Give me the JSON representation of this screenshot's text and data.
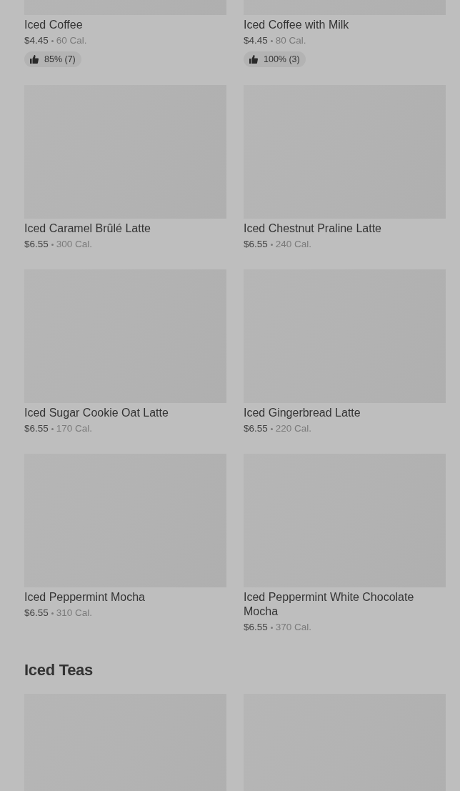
{
  "sections": [
    {
      "items": [
        {
          "kind": "picture",
          "name": "Iced Coffee",
          "price": "$4.45",
          "calories": "60 Cal.",
          "rating": "85% (7)"
        },
        {
          "kind": "picture",
          "name": "Iced Coffee with Milk",
          "price": "$4.45",
          "calories": "80 Cal.",
          "rating": "100% (3)"
        },
        {
          "kind": "picture",
          "name": "Iced Caramel Brûlé Latte",
          "price": "$6.55",
          "calories": "300 Cal."
        },
        {
          "kind": "picture",
          "name": "Iced Chestnut Praline Latte",
          "price": "$6.55",
          "calories": "240 Cal."
        },
        {
          "kind": "picture",
          "name": "Iced Sugar Cookie Oat Latte",
          "price": "$6.55",
          "calories": "170 Cal."
        },
        {
          "kind": "picture",
          "name": "Iced Gingerbread Latte",
          "price": "$6.55",
          "calories": "220 Cal."
        },
        {
          "kind": "picture",
          "name": "Iced Peppermint Mocha",
          "price": "$6.55",
          "calories": "310 Cal."
        },
        {
          "kind": "picture",
          "name": "Iced Peppermint White Chocolate Mocha",
          "price": "$6.55",
          "calories": "370 Cal."
        }
      ]
    },
    {
      "title": "Iced Teas"
    }
  ]
}
